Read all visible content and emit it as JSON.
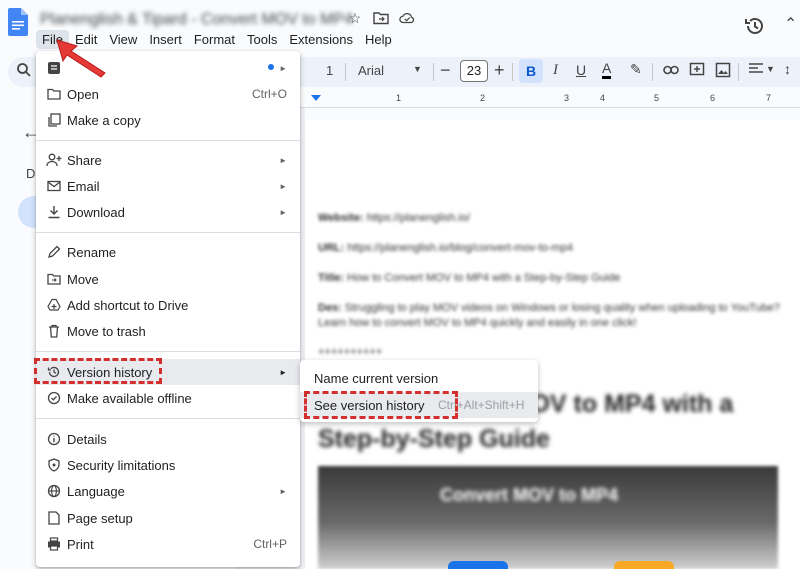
{
  "document": {
    "title": "Planenglish & Tipard - Convert MOV to MP4"
  },
  "menubar": [
    "File",
    "Edit",
    "View",
    "Insert",
    "Format",
    "Tools",
    "Extensions",
    "Help"
  ],
  "toolbar": {
    "style_value": "1",
    "font": "Arial",
    "font_size": "23",
    "bold_label": "B",
    "italic_label": "I",
    "underline_label": "U",
    "text_color_label": "A"
  },
  "ruler": [
    "1",
    "2",
    "3",
    "4",
    "5",
    "6",
    "7"
  ],
  "left_panel": {
    "letter": "D"
  },
  "file_menu": {
    "items": [
      {
        "label": "",
        "icon": "new-doc-icon",
        "submenu": true,
        "dot": true
      },
      {
        "label": "Open",
        "icon": "folder-icon",
        "shortcut": "Ctrl+O"
      },
      {
        "label": "Make a copy",
        "icon": "copy-icon"
      },
      {
        "label": "Share",
        "icon": "person-add-icon",
        "submenu": true
      },
      {
        "label": "Email",
        "icon": "mail-icon",
        "submenu": true
      },
      {
        "label": "Download",
        "icon": "download-icon",
        "submenu": true
      },
      {
        "label": "Rename",
        "icon": "pencil-icon"
      },
      {
        "label": "Move",
        "icon": "move-folder-icon"
      },
      {
        "label": "Add shortcut to Drive",
        "icon": "drive-shortcut-icon"
      },
      {
        "label": "Move to trash",
        "icon": "trash-icon"
      },
      {
        "label": "Version history",
        "icon": "history-icon",
        "submenu": true
      },
      {
        "label": "Make available offline",
        "icon": "offline-icon"
      },
      {
        "label": "Details",
        "icon": "info-icon"
      },
      {
        "label": "Security limitations",
        "icon": "security-icon"
      },
      {
        "label": "Language",
        "icon": "globe-icon",
        "submenu": true
      },
      {
        "label": "Page setup",
        "icon": "page-icon"
      },
      {
        "label": "Print",
        "icon": "print-icon",
        "shortcut": "Ctrl+P"
      }
    ]
  },
  "version_submenu": {
    "items": [
      {
        "label": "Name current version"
      },
      {
        "label": "See version history",
        "shortcut": "Ctrl+Alt+Shift+H"
      }
    ]
  },
  "page": {
    "website_label": "Website:",
    "website_value": "https://planenglish.io/",
    "url_label": "URL:",
    "url_value": "https://planenglish.io/blog/convert-mov-to-mp4",
    "title_label": "Title:",
    "title_value": "How to Convert MOV to MP4 with a Step-by-Step Guide",
    "desc_label": "Des:",
    "desc_value": "Struggling to play MOV videos on Windows or losing quality when uploading to YouTube?",
    "desc_value2": "Learn how to convert MOV to MP4 quickly and easily in one click!",
    "separator": "++++++++++",
    "heading_line1": "How to Convert MOV to MP4 with a",
    "heading_line2": "Step-by-Step Guide",
    "image_text": "Convert MOV to MP4"
  },
  "colors": {
    "accent": "#1a73e8",
    "highlight_red": "#d32f2f",
    "toolbar_bg": "#edf2fa"
  }
}
